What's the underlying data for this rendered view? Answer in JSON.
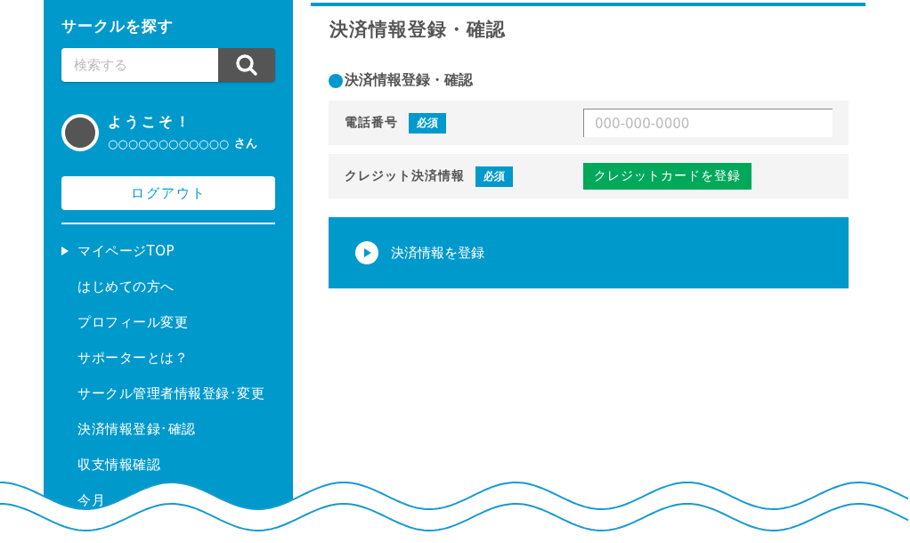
{
  "sidebar": {
    "title": "サークルを探す",
    "search": {
      "placeholder": "検索する"
    },
    "welcome": "ようこそ！",
    "user_name": "○○○○○○○○○○○○",
    "user_suffix": "さん",
    "logout": "ログアウト",
    "menu": [
      {
        "label": "マイページTOP",
        "selected": true
      },
      {
        "label": "はじめての方へ",
        "selected": false
      },
      {
        "label": "プロフィール変更",
        "selected": false
      },
      {
        "label": "サポーターとは？",
        "selected": false
      },
      {
        "label": "サークル管理者情報登録･変更",
        "selected": false
      },
      {
        "label": "決済情報登録･確認",
        "selected": false
      },
      {
        "label": "収支情報確認",
        "selected": false
      },
      {
        "label": "今月",
        "selected": false
      }
    ]
  },
  "main": {
    "title": "決済情報登録・確認",
    "section_heading": "決済情報登録・確認",
    "fields": [
      {
        "kind": "input",
        "label": "電話番号",
        "badge": "必須",
        "placeholder": "000-000-0000"
      },
      {
        "kind": "button",
        "label": "クレジット決済情報",
        "badge": "必須",
        "button": "クレジットカードを登録"
      }
    ],
    "submit": "決済情報を登録"
  }
}
